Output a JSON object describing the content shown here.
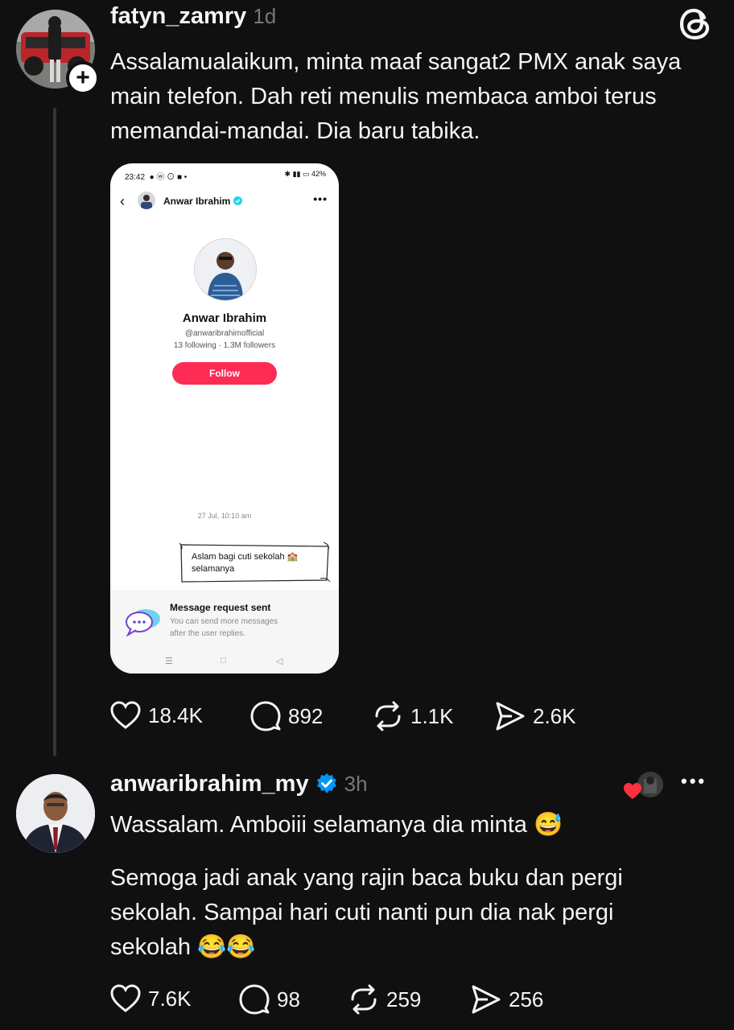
{
  "post1": {
    "username": "fatyn_zamry",
    "time": "1d",
    "text_lines": [
      "Assalamualaikum, minta maaf sangat2 PMX anak saya",
      "main telefon. Dah reti menulis membaca amboi terus",
      "memandai-mandai. Dia baru tabika."
    ],
    "likes": "18.4K",
    "replies": "892",
    "reposts": "1.1K",
    "shares": "2.6K"
  },
  "phone": {
    "status_time": "23:42",
    "battery": "42%",
    "header_name": "Anwar Ibrahim",
    "profile_name": "Anwar Ibrahim",
    "handle": "@anwaribrahimofficial",
    "stats": "13 following · 1.3M followers",
    "follow_label": "Follow",
    "message_date": "27 Jul, 10:10 am",
    "message_line1": "Aslam bagi cuti sekolah 🏫",
    "message_line2": "selamanya",
    "request_title": "Message request sent",
    "request_sub_line1": "You can send more messages",
    "request_sub_line2": "after the user replies."
  },
  "post2": {
    "username": "anwaribrahim_my",
    "time": "3h",
    "line1": "Wassalam. Amboiii selamanya dia minta 😅",
    "para2_lines": [
      "Semoga jadi anak yang rajin baca buku dan pergi",
      "sekolah. Sampai hari cuti nanti pun dia nak pergi",
      "sekolah 😂😂"
    ],
    "likes": "7.6K",
    "replies": "98",
    "reposts": "259",
    "shares": "256"
  },
  "colors": {
    "background": "#101010",
    "text": "#f3f5f7",
    "muted": "#777777",
    "verified": "#0095f6",
    "follow": "#fe2c55",
    "heart": "#ff3040"
  },
  "icons": [
    "threads-logo-icon",
    "plus-icon",
    "heart-icon",
    "comment-icon",
    "repost-icon",
    "share-icon",
    "verified-icon",
    "more-icon",
    "back-icon"
  ]
}
